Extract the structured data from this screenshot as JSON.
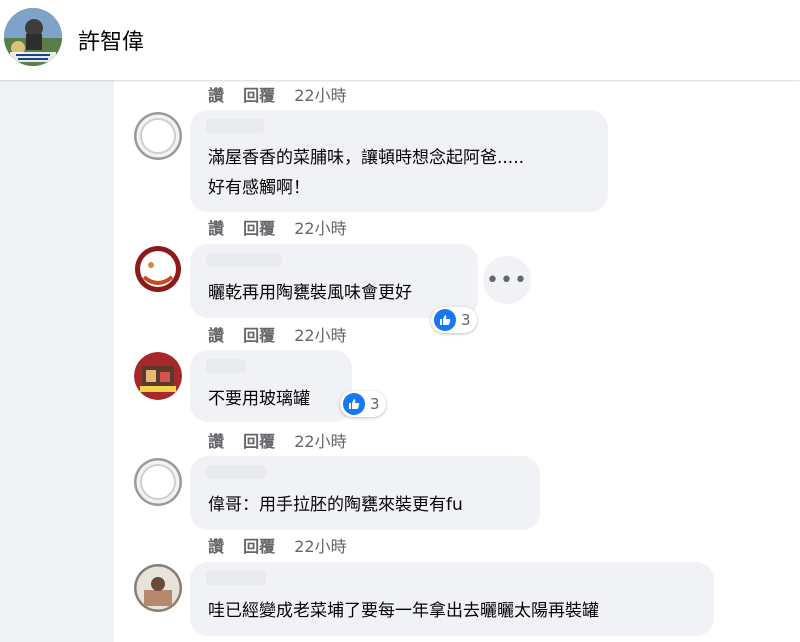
{
  "header": {
    "title": "許智偉"
  },
  "actions": {
    "like": "讚",
    "reply": "回覆"
  },
  "comments": [
    {
      "time": "22小時"
    },
    {
      "lines": [
        "滿屋香香的菜脯味，讓頓時想念起阿爸.....",
        "好有感觸啊！"
      ],
      "time": "22小時"
    },
    {
      "lines": [
        "曬乾再用陶甕裝風味會更好"
      ],
      "reactions": "3",
      "time": "22小時"
    },
    {
      "lines": [
        "不要用玻璃罐"
      ],
      "reactions": "3",
      "time": "22小時"
    },
    {
      "lines": [
        "偉哥：用手拉胚的陶甕來裝更有fu"
      ],
      "time": "22小時"
    },
    {
      "lines": [
        "哇已經變成老菜埔了要每一年拿出去曬曬太陽再裝罐"
      ]
    }
  ],
  "more_button": {
    "icon": "more-horizontal-icon"
  },
  "colors": {
    "like_blue": "#1877f2",
    "bubble": "#f0f2f5",
    "meta": "#65676b"
  }
}
